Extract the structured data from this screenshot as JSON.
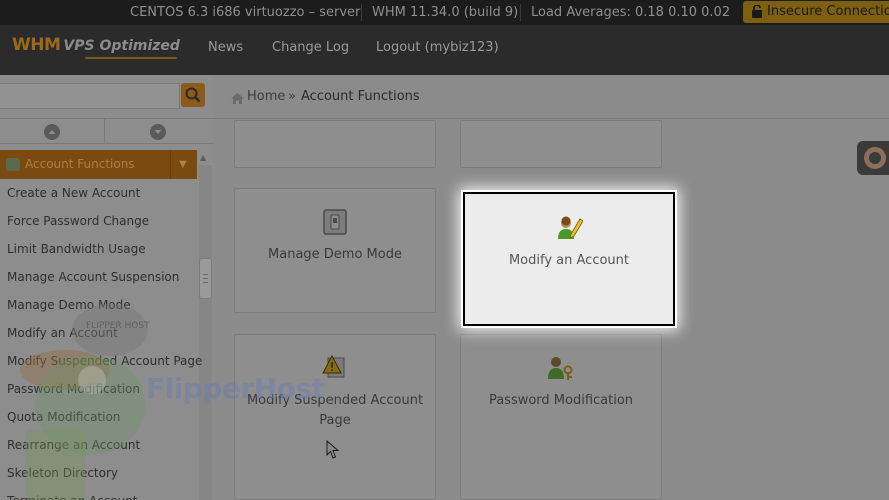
{
  "topbar": {
    "server": "CENTOS 6.3 i686 virtuozzo – server",
    "version": "WHM 11.34.0 (build 9)",
    "load": "Load Averages: 0.18 0.10 0.02",
    "insecure": "Insecure Connection"
  },
  "header": {
    "logo_main": "WHM",
    "logo_sub": "VPS Optimized",
    "nav": [
      "News",
      "Change Log",
      "Logout (mybiz123)"
    ]
  },
  "sidebar": {
    "search_value": "",
    "section_title": "Account Functions",
    "items": [
      "Create a New Account",
      "Force Password Change",
      "Limit Bandwidth Usage",
      "Manage Account Suspension",
      "Manage Demo Mode",
      "Modify an Account",
      "Modify Suspended Account Page",
      "Password Modification",
      "Quota Modification",
      "Rearrange an Account",
      "Skeleton Directory",
      "Terminate an Account"
    ]
  },
  "breadcrumb": {
    "home": "Home",
    "separator": "»",
    "current": "Account Functions"
  },
  "tiles": {
    "manage_demo": "Manage Demo Mode",
    "modify_account": "Modify an Account",
    "modify_suspended_line1": "Modify Suspended Account",
    "modify_suspended_line2": "Page",
    "password_mod": "Password Modification"
  },
  "watermark": {
    "brand": "FlipperHost",
    "hat": "FLIPPER HOST"
  },
  "colors": {
    "accent": "#d07a18",
    "topbar_bg": "#1c1c1c",
    "header_bg": "#2b2b2b",
    "highlight_bg": "#ececec"
  }
}
